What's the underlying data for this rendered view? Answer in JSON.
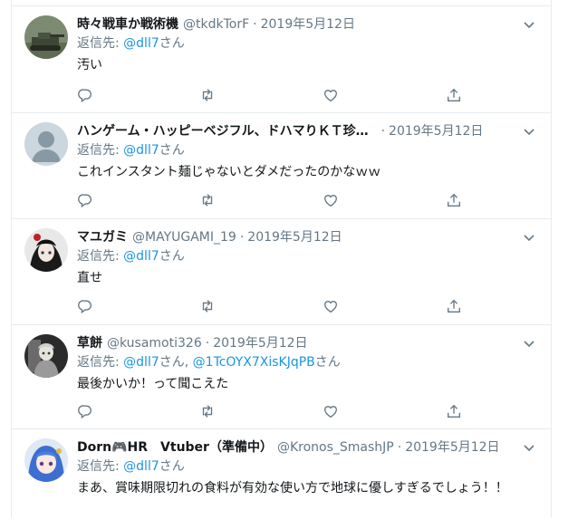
{
  "tweets": [
    {
      "name": "時々戦車か戦術機",
      "handle": "@tkdkTorF",
      "date": "2019年5月12日",
      "reply_prefix": "返信先: ",
      "reply_to": "@dll7",
      "reply_suffix": "さん",
      "reply_extra": "",
      "reply_extra_suffix": "",
      "text": "汚い",
      "avatar": "tank-photo"
    },
    {
      "name": "ハンゲーム・ハッピーベジフル、ドハマりＫＴ珍…",
      "handle": "",
      "date": "2019年5月12日",
      "reply_prefix": "返信先: ",
      "reply_to": "@dll7",
      "reply_suffix": "さん",
      "reply_extra": "",
      "reply_extra_suffix": "",
      "text": "これインスタント麺じゃないとダメだったのかなｗｗ",
      "avatar": "default-person"
    },
    {
      "name": "マユガミ",
      "handle": "@MAYUGAMI_19",
      "date": "2019年5月12日",
      "reply_prefix": "返信先: ",
      "reply_to": "@dll7",
      "reply_suffix": "さん",
      "reply_extra": "",
      "reply_extra_suffix": "",
      "text": "直せ",
      "avatar": "anime-dark"
    },
    {
      "name": "草餅",
      "handle": "@kusamoti326",
      "date": "2019年5月12日",
      "reply_prefix": "返信先: ",
      "reply_to": "@dll7",
      "reply_suffix": "さん, ",
      "reply_extra": "@1TcOYX7XisKJqPB",
      "reply_extra_suffix": "さん",
      "text": "最後かいか！って聞こえた",
      "avatar": "anime-grey"
    },
    {
      "name": "Dorn🎮HR　Vtuber（準備中）",
      "handle": "@Kronos_SmashJP",
      "date": "2019年5月12日",
      "reply_prefix": "返信先: ",
      "reply_to": "@dll7",
      "reply_suffix": "さん",
      "reply_extra": "",
      "reply_extra_suffix": "",
      "text": "まあ、賞味期限切れの食料が有効な使い方で地球に優しすぎるでしょう！！",
      "avatar": "anime-blue"
    }
  ],
  "separator": "·",
  "icons": {
    "caret": "chevron-down-icon",
    "reply": "reply-icon",
    "retweet": "retweet-icon",
    "like": "heart-icon",
    "share": "share-icon"
  },
  "colors": {
    "link": "#1b95e0",
    "secondary_text": "#657786",
    "border": "#e6ecf0",
    "icon": "#657786"
  }
}
